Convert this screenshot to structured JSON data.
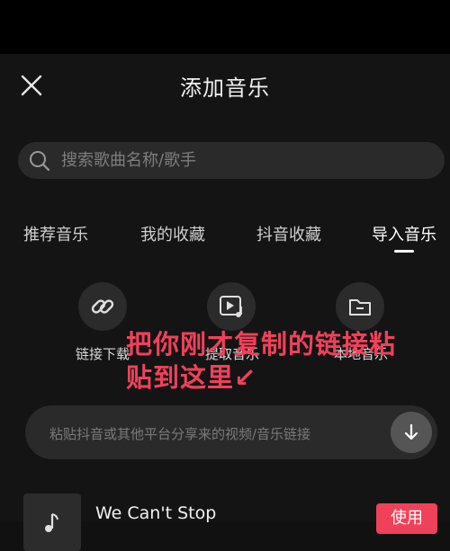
{
  "header": {
    "title": "添加音乐",
    "close_icon": "close-icon"
  },
  "search": {
    "placeholder": "搜索歌曲名称/歌手",
    "icon": "search-icon"
  },
  "tabs": [
    {
      "label": "推荐音乐",
      "active": false
    },
    {
      "label": "我的收藏",
      "active": false
    },
    {
      "label": "抖音收藏",
      "active": false
    },
    {
      "label": "导入音乐",
      "active": true
    }
  ],
  "import_options": [
    {
      "label": "链接下载",
      "icon": "link-icon"
    },
    {
      "label": "提取音乐",
      "icon": "video-music-icon"
    },
    {
      "label": "本地音乐",
      "icon": "folder-icon"
    }
  ],
  "overlay": {
    "line1": "把你刚才复制的链接粘",
    "line2": "贴到这里↙"
  },
  "paste": {
    "placeholder": "粘贴抖音或其他平台分享来的视频/音乐链接",
    "button_icon": "download-arrow-icon"
  },
  "song": {
    "title": "We Can't Stop",
    "use_label": "使用",
    "cover_icon": "music-note-icon"
  },
  "colors": {
    "accent": "#f0415a",
    "background": "#141414",
    "input_bg": "#2a2a2a"
  }
}
